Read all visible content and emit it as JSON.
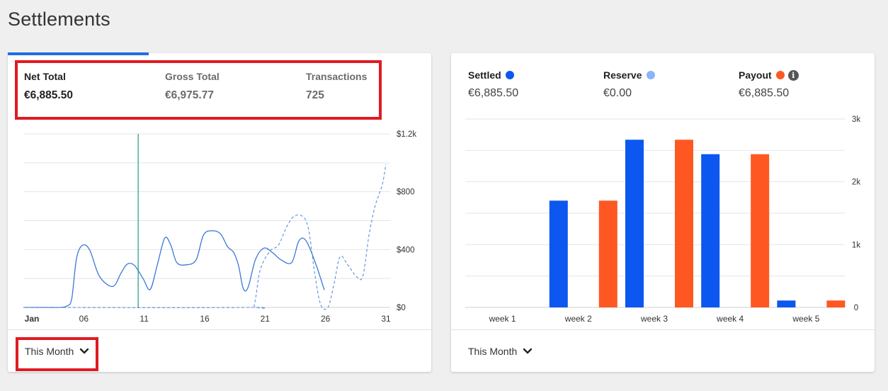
{
  "page": {
    "title": "Settlements"
  },
  "left_card": {
    "stats": [
      {
        "label": "Net Total",
        "value": "€6,885.50"
      },
      {
        "label": "Gross Total",
        "value": "€6,975.77"
      },
      {
        "label": "Transactions",
        "value": "725"
      }
    ],
    "period_dropdown": {
      "selected": "This Month"
    }
  },
  "right_card": {
    "stats": [
      {
        "label": "Settled",
        "value": "€6,885.50",
        "color": "#0b57f0"
      },
      {
        "label": "Reserve",
        "value": "€0.00",
        "color": "#8ab4f8"
      },
      {
        "label": "Payout",
        "value": "€6,885.50",
        "color": "#ff5722"
      }
    ],
    "period_dropdown": {
      "selected": "This Month"
    }
  },
  "colors": {
    "accent": "#1f6fe0",
    "highlight": "#e01b22",
    "settled": "#0b57f0",
    "payout": "#ff5722",
    "cursor": "#1a9b8c"
  },
  "chart_data": [
    {
      "type": "line",
      "x_ticks": [
        {
          "day": 1,
          "label": "Jan"
        },
        {
          "day": 6,
          "label": "06"
        },
        {
          "day": 11,
          "label": "11"
        },
        {
          "day": 16,
          "label": "16"
        },
        {
          "day": 21,
          "label": "21"
        },
        {
          "day": 26,
          "label": "26"
        },
        {
          "day": 31,
          "label": "31"
        }
      ],
      "y_ticks": [
        {
          "value": 0,
          "label": "$0"
        },
        {
          "value": 400,
          "label": "$400"
        },
        {
          "value": 800,
          "label": "$800"
        },
        {
          "value": 1200,
          "label": "$1.2k"
        }
      ],
      "ylim": [
        0,
        1200
      ],
      "xlim": [
        1,
        31
      ],
      "grid": true,
      "cursor_day": 10.5,
      "series": [
        {
          "style": "solid",
          "color": "#3a78d8",
          "points": [
            [
              1,
              0
            ],
            [
              3,
              0
            ],
            [
              4,
              0
            ],
            [
              4.6,
              10
            ],
            [
              5,
              60
            ],
            [
              5.4,
              340
            ],
            [
              5.9,
              430
            ],
            [
              6.5,
              395
            ],
            [
              7.3,
              215
            ],
            [
              8.4,
              145
            ],
            [
              9.1,
              240
            ],
            [
              9.6,
              300
            ],
            [
              10.2,
              290
            ],
            [
              10.9,
              200
            ],
            [
              11.5,
              125
            ],
            [
              12.1,
              300
            ],
            [
              12.7,
              480
            ],
            [
              13.2,
              430
            ],
            [
              13.7,
              310
            ],
            [
              14.5,
              295
            ],
            [
              15.3,
              330
            ],
            [
              15.9,
              500
            ],
            [
              16.6,
              530
            ],
            [
              17.3,
              510
            ],
            [
              17.9,
              420
            ],
            [
              18.4,
              380
            ],
            [
              18.8,
              290
            ],
            [
              19.2,
              130
            ],
            [
              19.6,
              140
            ],
            [
              20.2,
              330
            ],
            [
              20.9,
              410
            ],
            [
              21.6,
              380
            ],
            [
              22.3,
              330
            ],
            [
              23.2,
              310
            ],
            [
              23.8,
              460
            ],
            [
              24.4,
              460
            ],
            [
              25.2,
              300
            ],
            [
              25.9,
              120
            ]
          ]
        },
        {
          "style": "dashed",
          "color": "#5a8fdf",
          "points": [
            [
              1,
              0
            ],
            [
              19.5,
              0
            ],
            [
              20.1,
              20
            ],
            [
              20.6,
              260
            ],
            [
              21.4,
              390
            ],
            [
              22.1,
              430
            ],
            [
              22.8,
              560
            ],
            [
              23.4,
              630
            ],
            [
              24.1,
              630
            ],
            [
              24.6,
              540
            ],
            [
              25.1,
              240
            ],
            [
              25.6,
              20
            ],
            [
              26.2,
              0
            ],
            [
              26.7,
              160
            ],
            [
              27.2,
              350
            ],
            [
              27.8,
              300
            ],
            [
              28.6,
              210
            ],
            [
              29.1,
              220
            ],
            [
              29.6,
              500
            ],
            [
              30.1,
              700
            ],
            [
              30.7,
              850
            ],
            [
              31,
              990
            ]
          ]
        }
      ]
    },
    {
      "type": "bar",
      "categories": [
        "week 1",
        "week 2",
        "week 3",
        "week 4",
        "week 5"
      ],
      "series": [
        {
          "name": "Settled",
          "color": "#0b57f0",
          "values": [
            0,
            1700,
            2670,
            2440,
            110
          ]
        },
        {
          "name": "Payout",
          "color": "#ff5722",
          "values": [
            0,
            1700,
            2670,
            2440,
            110
          ]
        }
      ],
      "y_ticks": [
        {
          "value": 0,
          "label": "0"
        },
        {
          "value": 1000,
          "label": "1k"
        },
        {
          "value": 2000,
          "label": "2k"
        },
        {
          "value": 3000,
          "label": "3k"
        }
      ],
      "ylim": [
        0,
        3000
      ],
      "grid": true
    }
  ]
}
